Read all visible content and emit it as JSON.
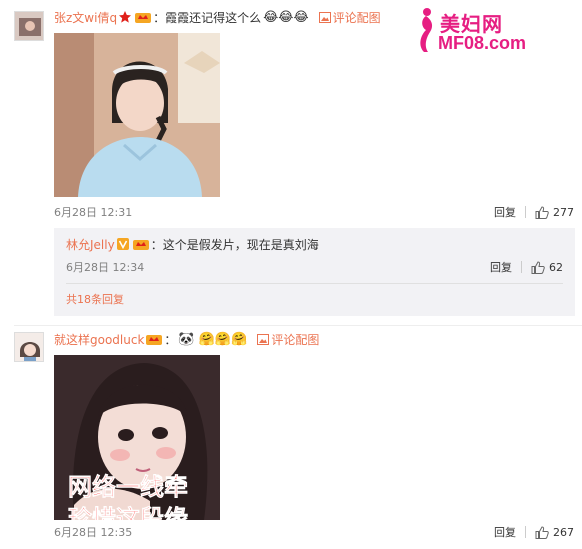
{
  "watermark": {
    "title": "美妇网",
    "site": "MF08.com"
  },
  "comments": [
    {
      "username": "张z文wi倩q",
      "text": "：霞霞还记得这个么",
      "emoji": "😂😂😂",
      "pic_link": "评论配图",
      "time": "6月28日 12:31",
      "reply_label": "回复",
      "likes": "277"
    },
    {
      "username": "就这样goodluck",
      "text": "：",
      "emoji": "🐼 🤗🤗🤗",
      "pic_link": "评论配图",
      "time": "6月28日 12:35",
      "reply_label": "回复",
      "likes": "267",
      "photo_overlay": [
        "网络一线牵",
        "珍惜这段缘"
      ]
    }
  ],
  "reply": {
    "username": "林允Jelly",
    "text": "：这个是假发片，现在是真刘海",
    "time": "6月28日 12:34",
    "reply_label": "回复",
    "likes": "62",
    "total_label": "共18条回复"
  },
  "colors": {
    "accent": "#eb7350",
    "reply_bg": "#f2f2f5",
    "watermark": "#e61e82"
  },
  "icons": [
    "verified-icon",
    "vip-crown-icon",
    "picture-icon",
    "thumbs-up-icon"
  ]
}
